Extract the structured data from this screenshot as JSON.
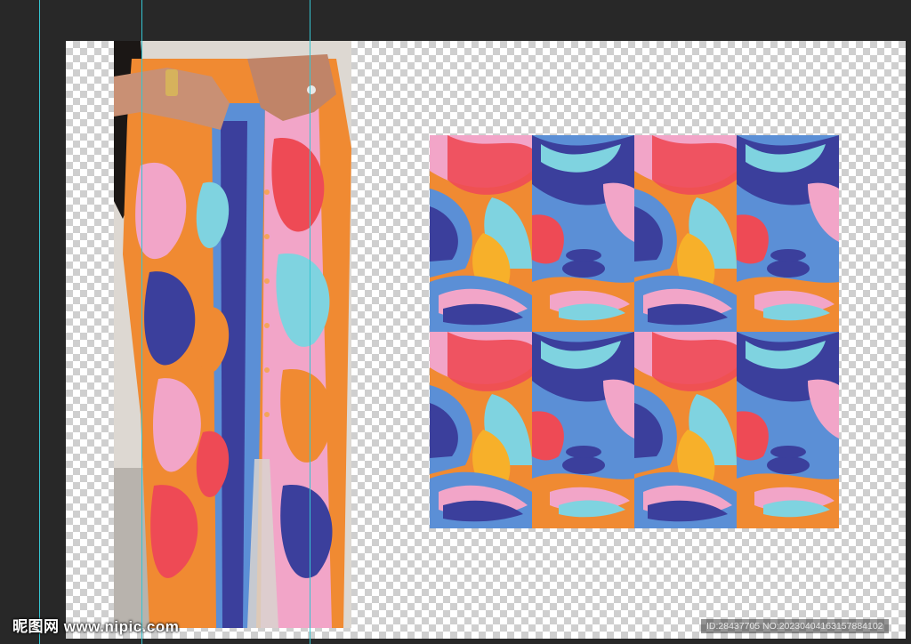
{
  "watermark": {
    "site_brand": "昵图网 www.nipic.com",
    "image_id": "ID:28437705 NO:20230404163157884102"
  },
  "colors": {
    "workspace": "#282828",
    "guide": "#35c5d1",
    "pattern_orange": "#f08a32",
    "pattern_pink": "#f2a5c8",
    "pattern_navy": "#3b3f9c",
    "pattern_sky": "#5b8fd6",
    "pattern_cyan": "#7fd3e0",
    "pattern_red": "#ee4a55"
  }
}
